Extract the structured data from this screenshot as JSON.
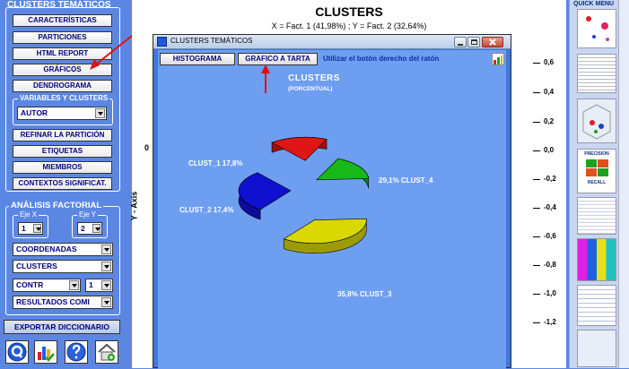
{
  "sidebar": {
    "header": "CLUSTERS TEMÁTICOS",
    "buttons": [
      "CARACTERÍSTICAS",
      "PARTICIONES",
      "HTML REPORT",
      "GRÁFICOS",
      "DENDROGRAMA"
    ],
    "var_legend": "VARIABLES Y CLUSTERS",
    "var_value": "AUTOR",
    "buttons2": [
      "REFINAR LA PARTICIÓN",
      "ETIQUETAS",
      "MIEMBROS",
      "CONTEXTOS SIGNIFICAT."
    ],
    "factorial_legend": "ANÁLISIS FACTORIAL",
    "eje_x_label": "Eje X",
    "eje_y_label": "Eje Y",
    "eje_x_value": "1",
    "eje_y_value": "2",
    "coordenadas": "COORDENADAS",
    "clusters": "CLUSTERS",
    "contr": "CONTR",
    "contr_num": "1",
    "resultados": "RESULTADOS COMI",
    "export": "EXPORTAR DICCIONARIO"
  },
  "main": {
    "title": "CLUSTERS",
    "subtitle": "X = Fact. 1 (41,98%) ; Y = Fact. 2 (32,64%)",
    "y_axis": "Y - Axis",
    "zero": "0",
    "ticks": [
      "0,6",
      "0,4",
      "0,2",
      "0,0",
      "-0,2",
      "-0,4",
      "-0,6",
      "-0,8",
      "-1,0",
      "-1,2"
    ]
  },
  "popup": {
    "title": "CLUSTERS TEMÁTICOS",
    "btn_histograma": "HISTOGRAMA",
    "btn_tarta": "GRAFICO A TARTA",
    "hint": "Utilizar el botón derecho del ratón",
    "chart_title": "CLUSTERS",
    "chart_subtitle": "(PORCENTUAL)"
  },
  "quick_menu": {
    "title": "QUICK MENU",
    "precision": "PRECISION",
    "recall": "RECALL"
  },
  "colors": {
    "bg": "#5b87e2",
    "chart_bg": "#6e9ef0",
    "red_arrow": "#e01010",
    "clust1": "#e01515",
    "clust2": "#18b818",
    "clust3": "#d8d800",
    "clust4": "#1010d0"
  },
  "chart_data": {
    "type": "pie",
    "title": "CLUSTERS",
    "subtitle": "(PORCENTUAL)",
    "labels": [
      "CLUST_1",
      "CLUST_2",
      "CLUST_3",
      "CLUST_4"
    ],
    "display_labels": [
      "CLUST_1  17,8%",
      "CLUST_2  17,4%",
      "35,8%  CLUST_3",
      "29,1%  CLUST_4"
    ],
    "values": [
      17.8,
      17.4,
      35.8,
      29.1
    ],
    "colors": [
      "#e01515",
      "#18b818",
      "#d8d800",
      "#1010d0"
    ]
  }
}
